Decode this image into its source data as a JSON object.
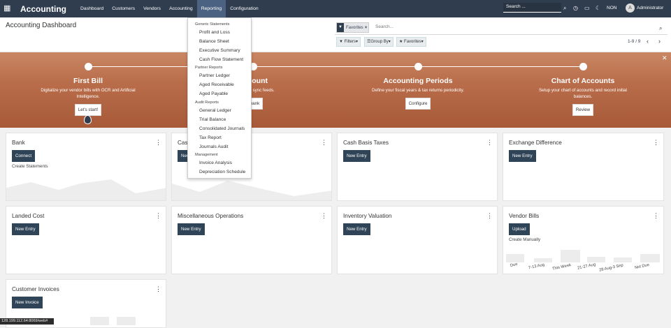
{
  "topbar": {
    "brand": "Accounting",
    "menu": [
      "Dashboard",
      "Customers",
      "Vendors",
      "Accounting",
      "Reporting",
      "Configuration"
    ],
    "search_placeholder": "Search ...",
    "lang": "NON",
    "user": "Administrator",
    "avatar_initial": "A"
  },
  "control": {
    "title": "Accounting Dashboard",
    "facet": "Favorites",
    "search_placeholder": "Search...",
    "filters": "Filters",
    "group_by": "Group By",
    "favorites": "Favorites",
    "pager": "1-9 / 9"
  },
  "banner": {
    "steps": [
      {
        "title": "First Bill",
        "desc": "Digitalize your vendor bills with OCR and Artificial Intelligence.",
        "button": "Let's start!"
      },
      {
        "title": "Account",
        "desc": "account to sync feeds.",
        "button": "a bank"
      },
      {
        "title": "Accounting Periods",
        "desc": "Define your fiscal years & tax returns periodicity.",
        "button": "Configure"
      },
      {
        "title": "Chart of Accounts",
        "desc": "Setup your chart of accounts and record initial balances.",
        "button": "Review"
      }
    ]
  },
  "reporting_menu": {
    "generic_header": "Generic Statements",
    "generic": [
      "Profit and Loss",
      "Balance Sheet",
      "Executive Summary",
      "Cash Flow Statement"
    ],
    "partner_header": "Partner Reports",
    "partner": [
      "Partner Ledger",
      "Aged Receivable",
      "Aged Payable"
    ],
    "audit_header": "Audit Reports",
    "audit": [
      "General Ledger",
      "Trial Balance",
      "Consolidated Journals",
      "Tax Report",
      "Journals Audit"
    ],
    "mgmt_header": "Management",
    "mgmt": [
      "Invoice Analysis",
      "Depreciation Schedule"
    ]
  },
  "cards": [
    {
      "title": "Bank",
      "button": "Connect",
      "sub": "Create Statements"
    },
    {
      "title": "Cas",
      "button": "New"
    },
    {
      "title": "Cash Basis Taxes",
      "button": "New Entry"
    },
    {
      "title": "Exchange Difference",
      "button": "New Entry"
    },
    {
      "title": "Landed Cost",
      "button": "New Entry"
    },
    {
      "title": "Miscellaneous Operations",
      "button": "New Entry"
    },
    {
      "title": "Inventory Valuation",
      "button": "New Entry"
    },
    {
      "title": "Vendor Bills",
      "button": "Upload",
      "sub": "Create Manually",
      "axis": [
        "Due",
        "7-13 Aug",
        "This Week",
        "21-27 Aug",
        "28 Aug-3 Sep",
        "Not Due"
      ]
    },
    {
      "title": "Customer Invoices",
      "button": "New Invoice"
    }
  ],
  "status_url": "128.199.112.64:8069/web#"
}
